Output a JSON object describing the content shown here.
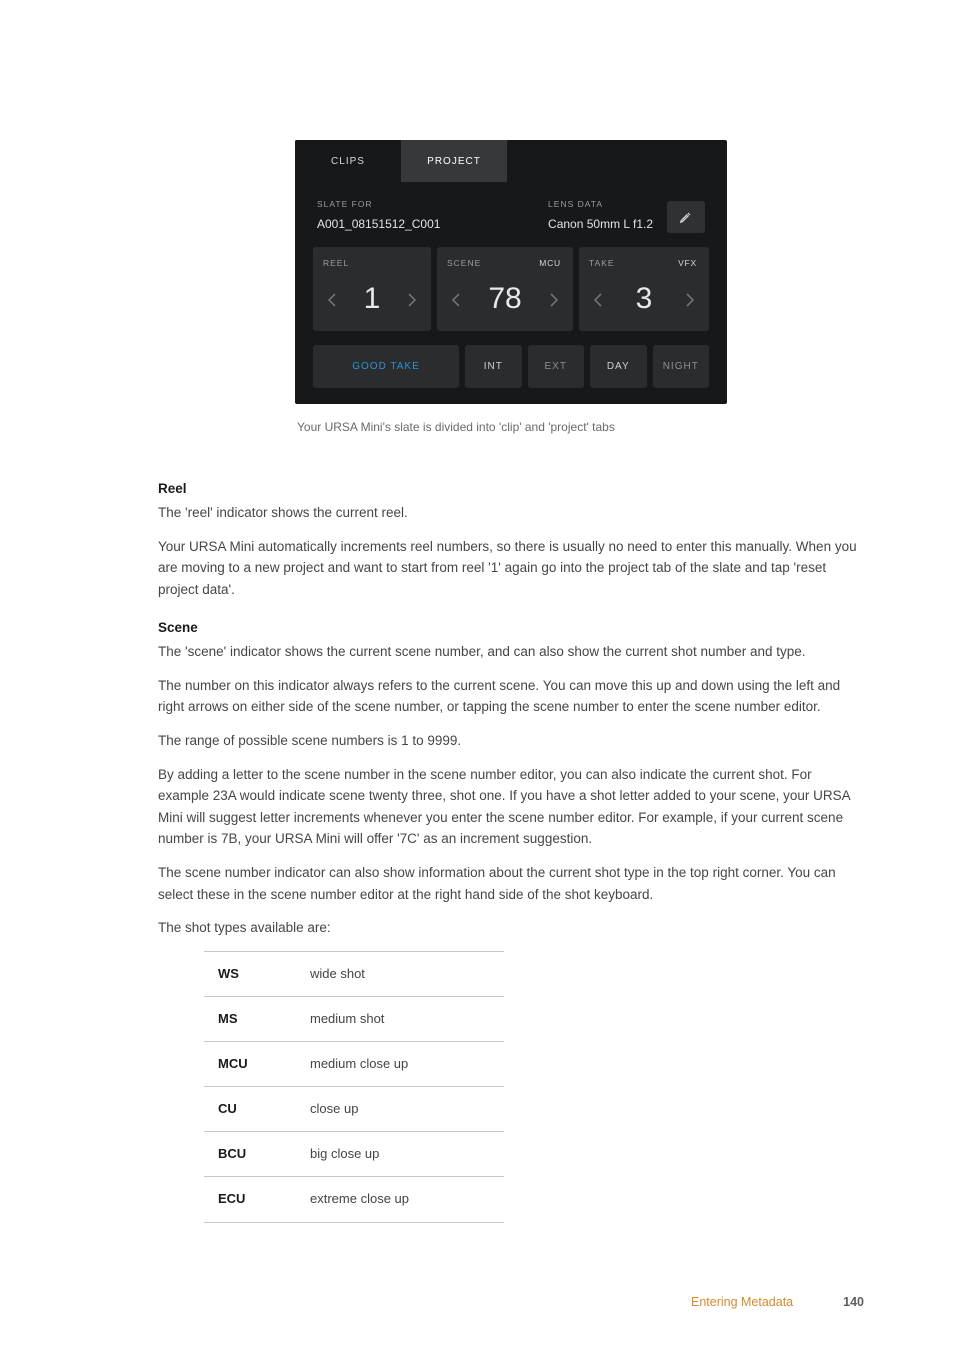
{
  "slate": {
    "tabs": {
      "clips": "CLIPS",
      "project": "PROJECT"
    },
    "slate_for_label": "SLATE FOR",
    "slate_for_value": "A001_08151512_C001",
    "lens_label": "LENS DATA",
    "lens_value": "Canon 50mm L f1.2",
    "reel": {
      "label": "REEL",
      "value": "1"
    },
    "scene": {
      "label": "SCENE",
      "value": "78",
      "badge": "MCU"
    },
    "take": {
      "label": "TAKE",
      "value": "3",
      "badge": "VFX"
    },
    "buttons": {
      "good": "GOOD TAKE",
      "int": "INT",
      "ext": "EXT",
      "day": "DAY",
      "night": "NIGHT"
    }
  },
  "caption": "Your URSA Mini's slate is divided into 'clip' and 'project' tabs",
  "reel": {
    "heading": "Reel",
    "p1": "The 'reel' indicator shows the current reel.",
    "p2": "Your URSA Mini automatically increments reel numbers, so there is usually no need to enter this manually. When you are moving to a new project and want to start from reel '1' again go into the project tab of the slate and tap 'reset project data'."
  },
  "scene": {
    "heading": "Scene",
    "p1": "The 'scene' indicator shows the current scene number, and can also show the current shot number and type.",
    "p2": "The number on this indicator always refers to the current scene. You can move this up and down using the left and right arrows on either side of the scene number, or tapping the scene number to enter the scene number editor.",
    "p3": "The range of possible scene numbers is 1 to 9999.",
    "p4": "By adding a letter to the scene number in the scene number editor, you can also indicate the current shot. For example 23A would indicate scene twenty three, shot one. If you have a shot letter added to your scene, your URSA Mini will suggest letter increments whenever you enter the scene number editor. For example, if your current scene number is 7B, your URSA Mini will offer '7C' as an increment suggestion.",
    "p5": "The scene number indicator can also show information about the current shot type in the top right corner. You can select these in the scene number editor at the right hand side of the shot keyboard.",
    "p6": "The shot types available are:"
  },
  "shot_types": [
    {
      "abbr": "WS",
      "desc": "wide shot"
    },
    {
      "abbr": "MS",
      "desc": "medium shot"
    },
    {
      "abbr": "MCU",
      "desc": "medium close up"
    },
    {
      "abbr": "CU",
      "desc": "close up"
    },
    {
      "abbr": "BCU",
      "desc": "big close up"
    },
    {
      "abbr": "ECU",
      "desc": "extreme close up"
    }
  ],
  "footer": {
    "section": "Entering Metadata",
    "page": "140"
  }
}
